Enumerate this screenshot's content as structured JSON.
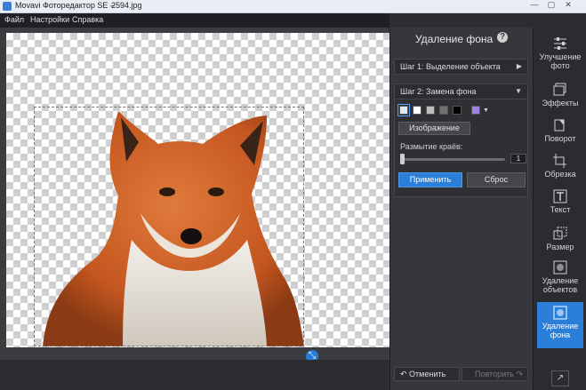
{
  "window": {
    "app_title": "Movavi Фоторедактор SE –",
    "filename": "2594.jpg"
  },
  "menu": {
    "items": [
      "Файл",
      "Настройки",
      "Справка"
    ]
  },
  "panel": {
    "title": "Удаление фона",
    "step1_label": "Шаг 1: Выделение объекта",
    "step2_label": "Шаг 2: Замена фона",
    "swatch_colors": [
      "#ffffff",
      "#ffffff",
      "#bdbdbd",
      "#707070",
      "#000000",
      "#a080e0"
    ],
    "image_button": "Изображение",
    "blur_label": "Размытие краёв:",
    "blur_value": "1",
    "apply_button": "Применить",
    "reset_button": "Сброс",
    "undo_button": "Отменить",
    "redo_button": "Повторить"
  },
  "tools": [
    {
      "label": "Улучшение фото",
      "icon": "sliders-icon"
    },
    {
      "label": "Эффекты",
      "icon": "effects-icon"
    },
    {
      "label": "Поворот",
      "icon": "rotate-icon"
    },
    {
      "label": "Обрезка",
      "icon": "crop-icon"
    },
    {
      "label": "Текст",
      "icon": "text-icon"
    },
    {
      "label": "Размер",
      "icon": "resize-icon"
    },
    {
      "label": "Удаление объектов",
      "icon": "object-removal-icon"
    },
    {
      "label": "Удаление фона",
      "icon": "background-removal-icon"
    }
  ],
  "colors": {
    "accent": "#2b7fd8",
    "panel_bg": "#35373b",
    "toolbar_bg": "#2a2c30"
  }
}
